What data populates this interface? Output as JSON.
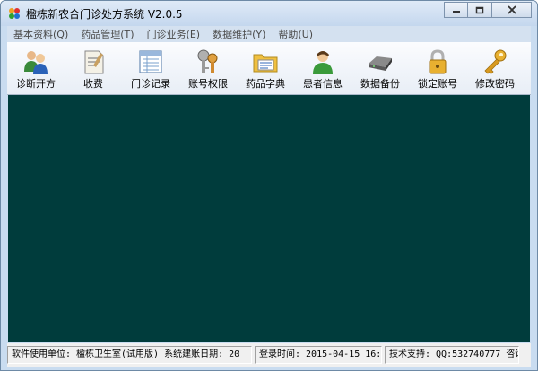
{
  "window": {
    "title": "楹栋新农合门诊处方系统 V2.0.5",
    "controls": {
      "minimize": "minimize",
      "restore": "restore",
      "close": "close"
    }
  },
  "menu": [
    "基本资料(Q)",
    "药品管理(T)",
    "门诊业务(E)",
    "数据维护(Y)",
    "帮助(U)"
  ],
  "toolbar": [
    {
      "label": "诊断开方",
      "icon": "doctors-icon"
    },
    {
      "label": "收费",
      "icon": "receipt-icon"
    },
    {
      "label": "门诊记录",
      "icon": "records-icon"
    },
    {
      "label": "账号权限",
      "icon": "keys-icon"
    },
    {
      "label": "药品字典",
      "icon": "folder-icon"
    },
    {
      "label": "患者信息",
      "icon": "patient-icon"
    },
    {
      "label": "数据备份",
      "icon": "disk-icon"
    },
    {
      "label": "锁定账号",
      "icon": "lock-icon"
    },
    {
      "label": "修改密码",
      "icon": "key-icon"
    }
  ],
  "status": {
    "unit": "软件使用单位: 楹栋卫生室(试用版) 系统建账日期: 20",
    "login": "登录时间: 2015-04-15 16:12",
    "support": "技术支持: QQ:532740777 咨询"
  },
  "colors": {
    "workspace": "#003c3c",
    "frame": "#c9dcf0"
  }
}
